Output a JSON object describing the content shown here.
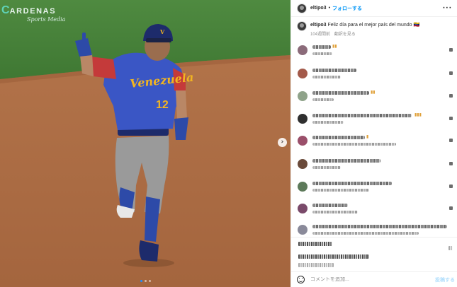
{
  "photo": {
    "watermark_title": "ARDENAS",
    "watermark_c": "C",
    "watermark_sub": "Sports Media",
    "jersey_text": "Venezuela",
    "jersey_number": "12",
    "helmet_mark": "V",
    "next_icon": "chevron-right-icon",
    "carousel_dots": 3
  },
  "header": {
    "username": "eltipo3",
    "separator": "•",
    "follow_label": "フォローする",
    "more_icon": "more-horizontal-icon",
    "more_glyph": "···"
  },
  "caption": {
    "username": "eltipo3",
    "text": "Feliz día para el mejor país del mundo 🇻🇪",
    "time_ago": "104週間前",
    "translate_label": "翻訳を見る"
  },
  "comments_note": "Comment usernames and texts are pixelated in the screenshot",
  "add_comment": {
    "placeholder": "コメントを追加...",
    "post_label": "投稿する"
  },
  "colors": {
    "follow_blue": "#0095f6",
    "post_disabled": "#b2dffc",
    "meta_gray": "#8e8e8e",
    "divider": "#efefef"
  }
}
